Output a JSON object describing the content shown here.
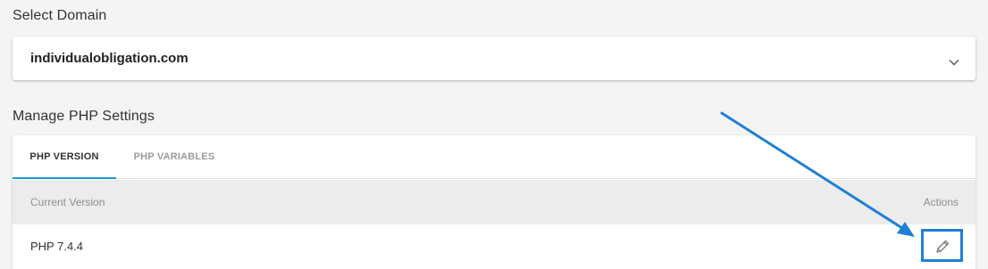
{
  "domain_section": {
    "label": "Select Domain",
    "selected_domain": "individualobligation.com"
  },
  "php_section": {
    "label": "Manage PHP Settings",
    "tabs": [
      {
        "label": "PHP VERSION",
        "active": true
      },
      {
        "label": "PHP VARIABLES",
        "active": false
      }
    ],
    "table": {
      "columns": [
        "Current Version",
        "Actions"
      ],
      "rows": [
        {
          "version": "PHP 7.4.4"
        }
      ]
    }
  },
  "icons": {
    "dropdown": "chevron-down-icon",
    "edit": "pencil-icon"
  },
  "colors": {
    "tab_active_indicator": "#1a9ad6",
    "annotation_highlight": "#1f7fd6"
  }
}
